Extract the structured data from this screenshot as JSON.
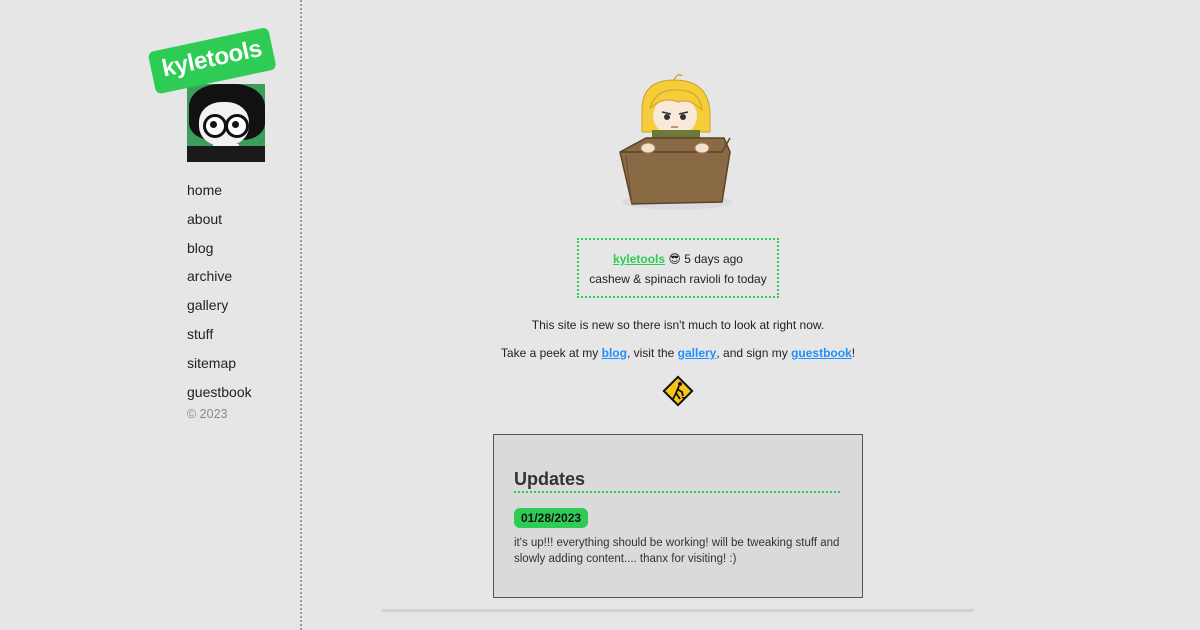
{
  "sidebar": {
    "site_name": "kyletools",
    "nav": [
      "home",
      "about",
      "blog",
      "archive",
      "gallery",
      "stuff",
      "sitemap",
      "guestbook"
    ],
    "copyright": "© 2023"
  },
  "status": {
    "user": "kyletools",
    "emoji": "😎",
    "time": "5 days ago",
    "message": "cashew & spinach ravioli fo today"
  },
  "intro": {
    "line1": "This site is new so there isn't much to look at right now.",
    "take_peek": "Take a peek at my ",
    "blog_link": "blog",
    "visit": ", visit the ",
    "gallery_link": "gallery",
    "sign": ", and sign my ",
    "guestbook_link": "guestbook",
    "end": "!"
  },
  "updates": {
    "title": "Updates",
    "entries": [
      {
        "date": "01/28/2023",
        "text": "it's up!!! everything should be working! will be tweaking stuff and slowly adding content.... thanx for visiting! :)"
      }
    ]
  },
  "colors": {
    "accent": "#2ecc55",
    "link": "#1e90ff",
    "background": "#e6e6e6",
    "panel": "#dadada"
  },
  "icons": {
    "construction": "construction-sign-icon",
    "hero": "girl-in-box-illustration"
  }
}
